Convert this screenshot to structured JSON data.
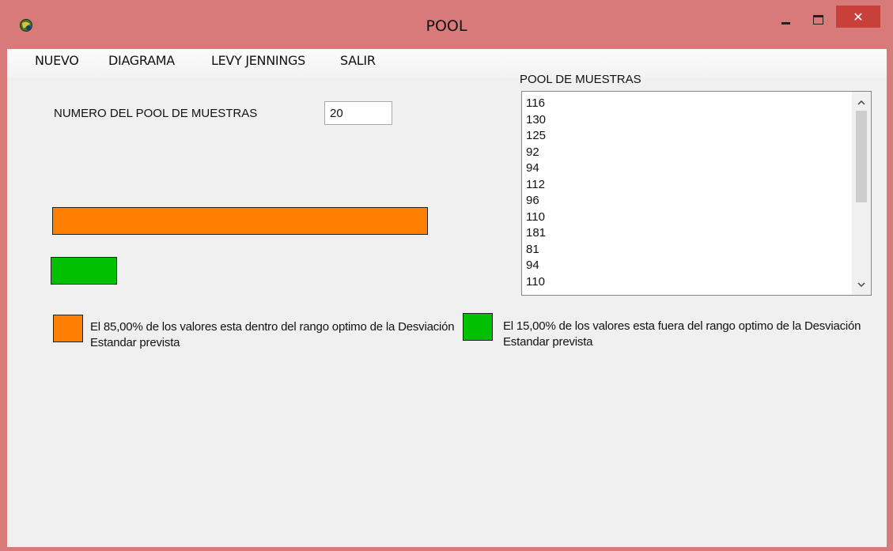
{
  "window": {
    "title": "POOL",
    "app_icon": "globe-icon",
    "minimize_icon": "minimize-icon",
    "maximize_icon": "maximize-icon",
    "close_label": "✕"
  },
  "menu": {
    "items": [
      "NUEVO",
      "DIAGRAMA",
      "LEVY JENNINGS",
      "SALIR"
    ]
  },
  "form": {
    "count_label": "NUMERO DEL POOL DE MUESTRAS",
    "count_value": "20"
  },
  "pool": {
    "label": "POOL DE MUESTRAS",
    "items": [
      "116",
      "130",
      "125",
      "92",
      "94",
      "112",
      "96",
      "110",
      "181",
      "81",
      "94",
      "110"
    ]
  },
  "results": {
    "within_percent": 85,
    "outside_percent": 15,
    "within_text": "El 85,00% de los valores esta dentro del rango optimo de la Desviación Estandar prevista",
    "outside_text": "El 15,00% de los valores esta fuera del rango optimo de la Desviación Estandar prevista",
    "within_color": "#ff8000",
    "outside_color": "#00c000"
  }
}
